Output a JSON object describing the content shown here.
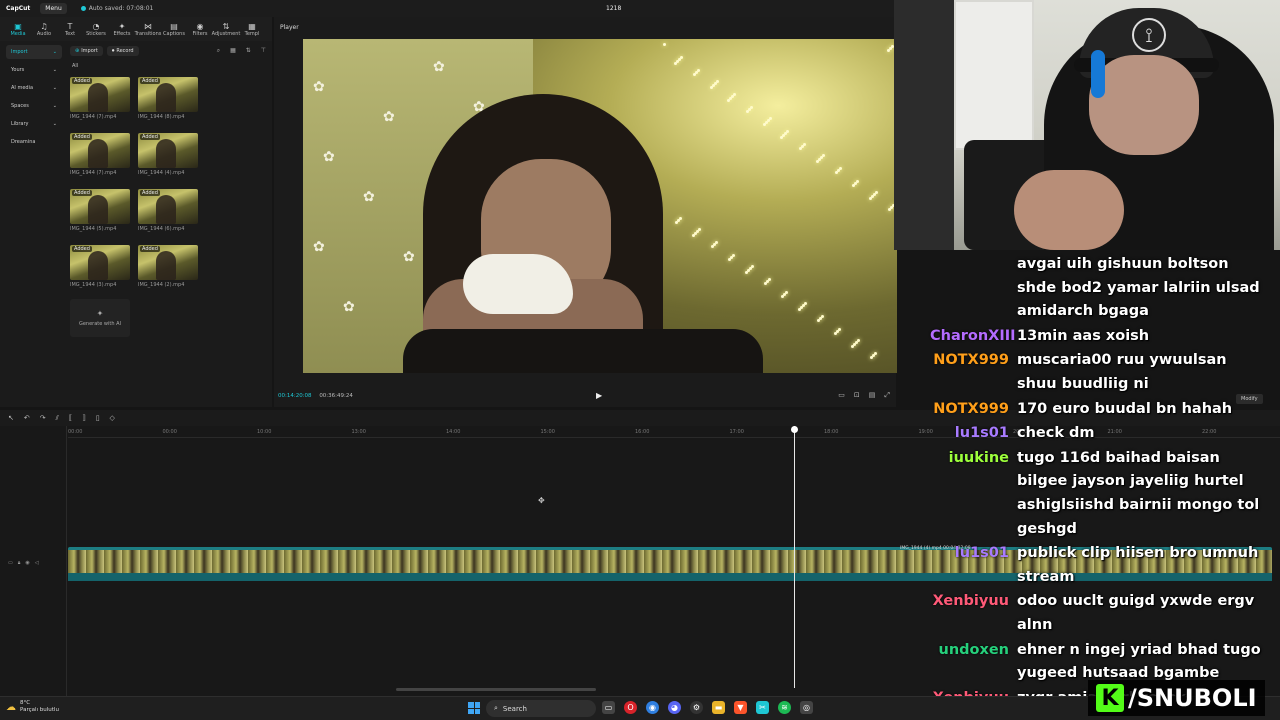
{
  "titlebar": {
    "logo": "CapCut",
    "menu": "Menu",
    "autosave": "Auto saved: 07:08:01",
    "project_title": "1218"
  },
  "toolbar": [
    {
      "label": "Media",
      "icon": "media-icon",
      "glyph": "▣"
    },
    {
      "label": "Audio",
      "icon": "audio-icon",
      "glyph": "♫"
    },
    {
      "label": "Text",
      "icon": "text-icon",
      "glyph": "T"
    },
    {
      "label": "Stickers",
      "icon": "sticker-icon",
      "glyph": "◔"
    },
    {
      "label": "Effects",
      "icon": "effects-icon",
      "glyph": "✦"
    },
    {
      "label": "Transitions",
      "icon": "transitions-icon",
      "glyph": "⋈"
    },
    {
      "label": "Captions",
      "icon": "captions-icon",
      "glyph": "▤"
    },
    {
      "label": "Filters",
      "icon": "filters-icon",
      "glyph": "◉"
    },
    {
      "label": "Adjustment",
      "icon": "adjust-icon",
      "glyph": "⇅"
    },
    {
      "label": "Templ",
      "icon": "template-icon",
      "glyph": "▦"
    }
  ],
  "sidebar": [
    {
      "label": "Import",
      "active": true
    },
    {
      "label": "Yours"
    },
    {
      "label": "AI media"
    },
    {
      "label": "Spaces"
    },
    {
      "label": "Library"
    },
    {
      "label": "Dreamina"
    }
  ],
  "media": {
    "import": "Import",
    "record": "Record",
    "all": "All",
    "added": "Added",
    "generate": "Generate with AI",
    "clips": [
      "IMG_1944 (7).mp4",
      "IMG_1944 (8).mp4",
      "IMG_1944 (7).mp4",
      "IMG_1944 (4).mp4",
      "IMG_1944 (5).mp4",
      "IMG_1944 (6).mp4",
      "IMG_1944 (3).mp4",
      "IMG_1944 (2).mp4"
    ]
  },
  "player": {
    "title": "Player",
    "current_time": "00:14:20:08",
    "total_time": "00:36:49:24"
  },
  "timeline": {
    "ticks": [
      "00:00",
      "00:00",
      "10:00",
      "13:00",
      "14:00",
      "15:00",
      "16:00",
      "17:00",
      "18:00",
      "19:00",
      "20:00",
      "21:00",
      "22:00",
      "13:00"
    ],
    "clip_label": "IMG_1944 (4).mp4  00:04:32:08",
    "modify": "Modify"
  },
  "chat": [
    {
      "user": "",
      "text": "avgai uih gishuun boltson shde bod2 yamar lalriin ulsad amidarch bgaga",
      "color": "#ffffff"
    },
    {
      "user": "CharonXIII",
      "text": "13min aas xoish",
      "color": "#b46cff"
    },
    {
      "user": "NOTX999",
      "text": "muscaria00 ruu ywuulsan shuu buudliig ni",
      "color": "#ff9f1a"
    },
    {
      "user": "NOTX999",
      "text": "170 euro buudal bn hahah",
      "color": "#ff9f1a"
    },
    {
      "user": "lu1s01",
      "text": "check dm",
      "color": "#a87bff"
    },
    {
      "user": "iuukine",
      "text": "tugo 116d baihad baisan bilgee jayson jayeliig hurtel ashiglsiishd bairnii mongo tol geshgd",
      "color": "#9dff3c"
    },
    {
      "user": "lu1s01",
      "text": "publick clip hiisen bro umnuh stream",
      "color": "#a87bff"
    },
    {
      "user": "Xenbiyuu",
      "text": "odoo uuclt guigd yxwde ergv alnn",
      "color": "#ff5a78"
    },
    {
      "user": "undoxen",
      "text": "ehner n ingej yriad bhad tugo yugeed hutsaad bgambe",
      "color": "#26d07c"
    },
    {
      "user": "Xenbiyuu",
      "text": "zvgr amia xorl keshx",
      "color": "#ff5a78"
    }
  ],
  "taskbar": {
    "temp": "8°C",
    "weather": "Parçalı bulutlu",
    "search": "Search"
  },
  "brand": {
    "icon": "K",
    "text": "/SNUBOLI",
    "accent": "#53fc18"
  },
  "colors": {
    "accent": "#1fc7d4"
  }
}
